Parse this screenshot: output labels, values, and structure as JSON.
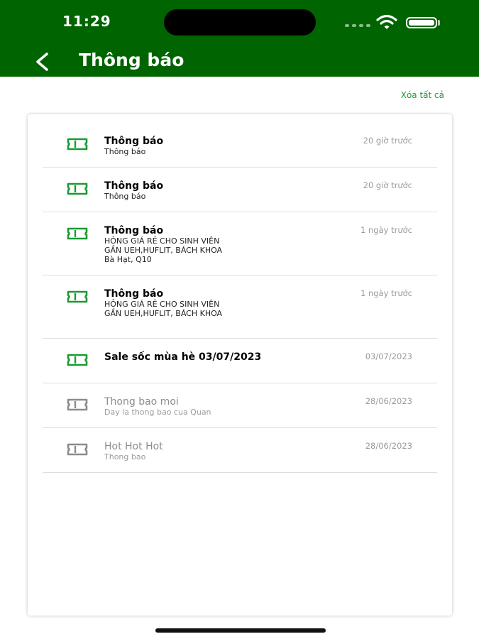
{
  "status_bar": {
    "time": "11:29"
  },
  "header": {
    "title": "Thông báo",
    "back_icon": "chevron-left-icon"
  },
  "actions": {
    "clear_all": "Xóa tất cả"
  },
  "colors": {
    "header": "#006400",
    "accent": "#1a9b33",
    "read_icon": "#8c8c8c"
  },
  "notifications": [
    {
      "title": "Thông báo",
      "body": [
        "Thông báo"
      ],
      "time": "20 giờ trước",
      "read": false
    },
    {
      "title": "Thông báo",
      "body": [
        "Thông báo"
      ],
      "time": "20 giờ trước",
      "read": false
    },
    {
      "title": "Thông báo",
      "body": [
        "HỎNG GIÁ RẺ CHO SINH VIÊN",
        "GẦN UEH,HUFLIT, BÁCH KHOA",
        "Bà Hạt, Q10"
      ],
      "time": "1 ngày trước",
      "read": false
    },
    {
      "title": "Thông báo",
      "body": [
        "HỎNG GIÁ RẺ CHO SINH VIÊN",
        "GẦN UEH,HUFLIT, BÁCH KHOA"
      ],
      "time": "1 ngày trước",
      "read": false
    },
    {
      "title": "Sale sốc mùa hè 03/07/2023",
      "body": [],
      "time": "03/07/2023",
      "read": false
    },
    {
      "title": "Thong bao moi",
      "body": [
        "Day la thong bao cua Quan"
      ],
      "time": "28/06/2023",
      "read": true
    },
    {
      "title": "Hot Hot Hot",
      "body": [
        "Thong bao"
      ],
      "time": "28/06/2023",
      "read": true
    }
  ]
}
